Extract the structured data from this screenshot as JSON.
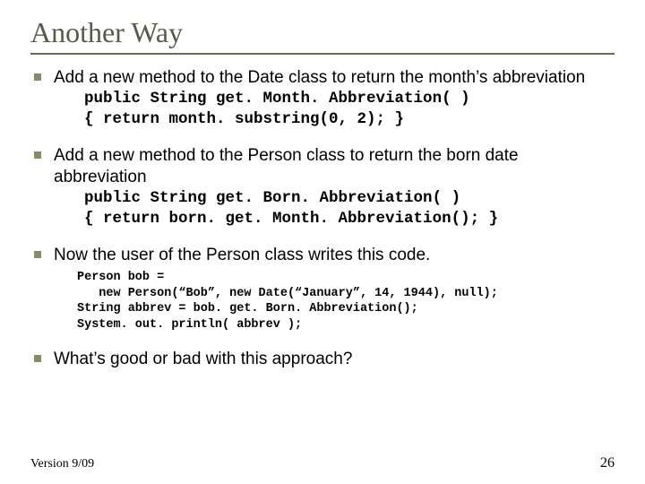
{
  "title": "Another Way",
  "bullets": [
    {
      "text": "Add a new method to the Date class to return the month’s abbreviation",
      "code": "public String get. Month. Abbreviation( )\n{ return month. substring(0, 2); }"
    },
    {
      "text": "Add a new method to the Person class to return the born date abbreviation",
      "code": "public String get. Born. Abbreviation( )\n{ return born. get. Month. Abbreviation(); }"
    },
    {
      "text": "Now the user of the Person class writes this code.",
      "code_small": "Person bob =\n   new Person(“Bob”, new Date(“January”, 14, 1944), null);\nString abbrev = bob. get. Born. Abbreviation();\nSystem. out. println( abbrev );"
    },
    {
      "text": "What’s good or bad with this approach?"
    }
  ],
  "footer": {
    "version": "Version 9/09",
    "page": "26"
  }
}
